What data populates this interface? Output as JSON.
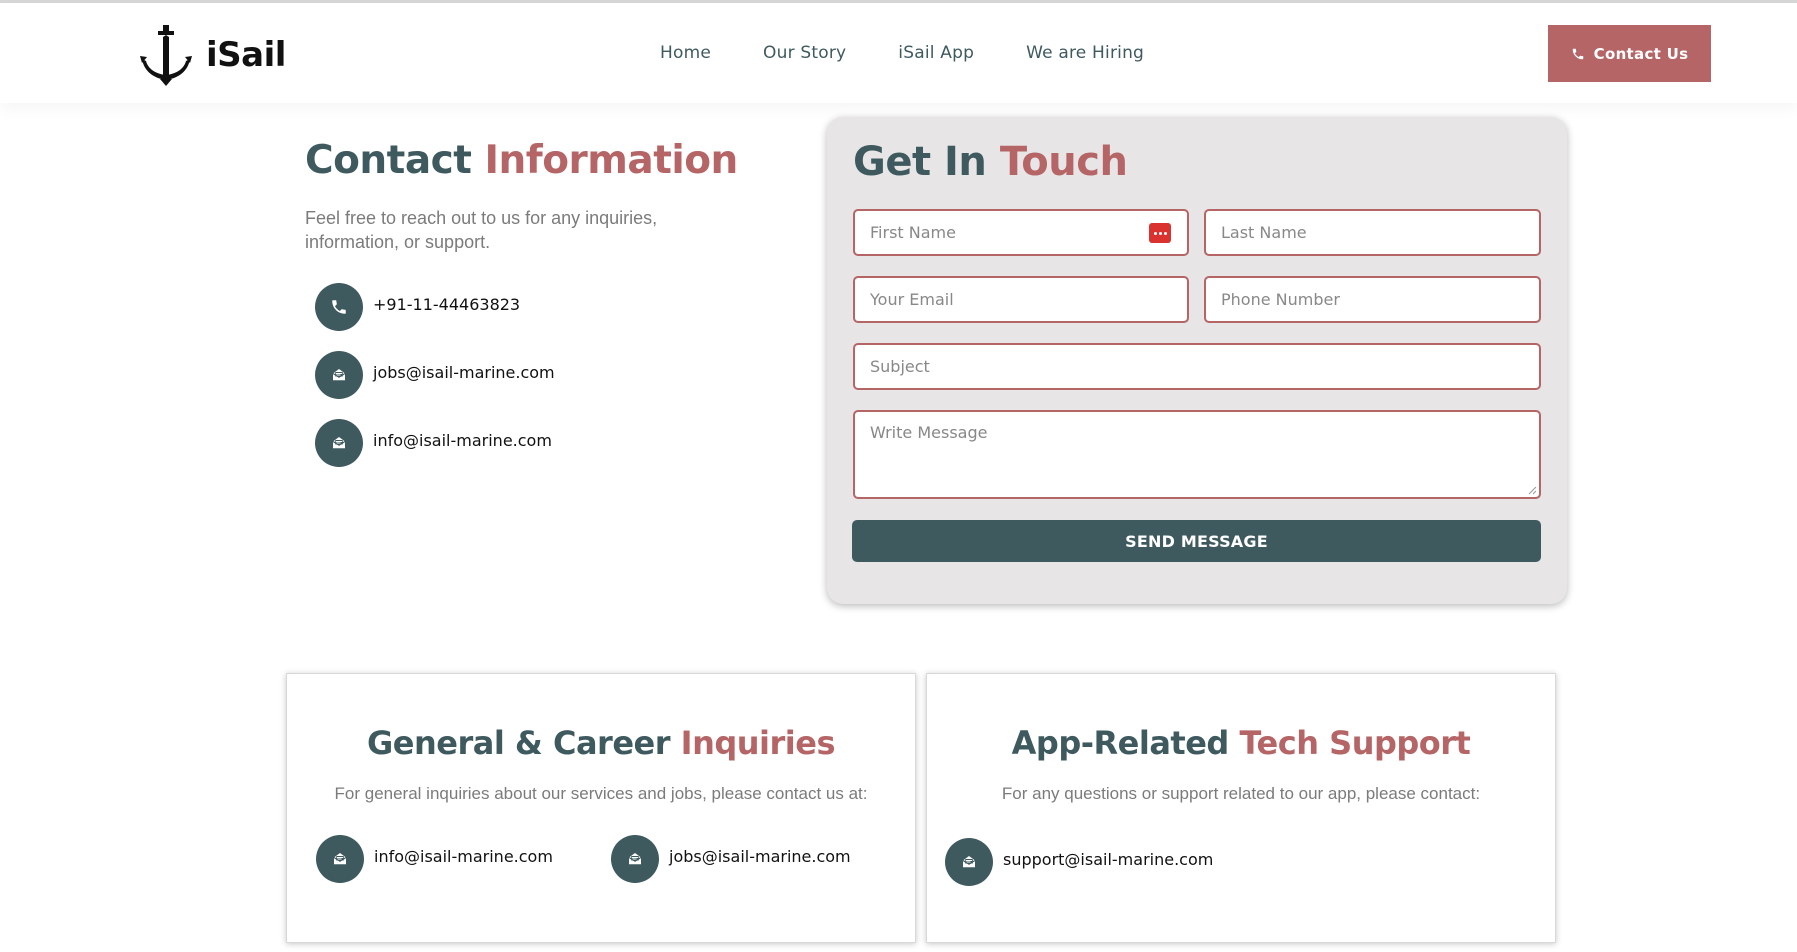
{
  "header": {
    "logo_text": "iSail",
    "nav": [
      "Home",
      "Our Story",
      "iSail App",
      "We are Hiring"
    ],
    "cta_label": "Contact Us"
  },
  "contact_info": {
    "title_part1": "Contact",
    "title_part2": "Information",
    "description": "Feel free to reach out to us for any inquiries, information, or support.",
    "phone": "+91-11-44463823",
    "email_jobs": "jobs@isail-marine.com",
    "email_info": "info@isail-marine.com"
  },
  "form": {
    "title_part1": "Get In",
    "title_part2": "Touch",
    "first_name_placeholder": "First Name",
    "last_name_placeholder": "Last Name",
    "email_placeholder": "Your Email",
    "phone_placeholder": "Phone Number",
    "subject_placeholder": "Subject",
    "message_placeholder": "Write Message",
    "submit_label": "SEND MESSAGE"
  },
  "cards": {
    "general": {
      "title_part1": "General & Career",
      "title_part2": "Inquiries",
      "description": "For general inquiries about our services and jobs, please contact us at:",
      "email_info": "info@isail-marine.com",
      "email_jobs": "jobs@isail-marine.com"
    },
    "tech": {
      "title_part1": "App-Related",
      "title_part2": "Tech Support",
      "description": "For any questions or support related to our app, please contact:",
      "email_support": "support@isail-marine.com"
    }
  },
  "colors": {
    "primary_dark": "#3f5a5f",
    "accent": "#b56566",
    "form_bg": "#e8e5e6"
  },
  "icons": [
    "anchor-icon",
    "phone-icon",
    "mail-open-icon",
    "password-manager-icon"
  ]
}
